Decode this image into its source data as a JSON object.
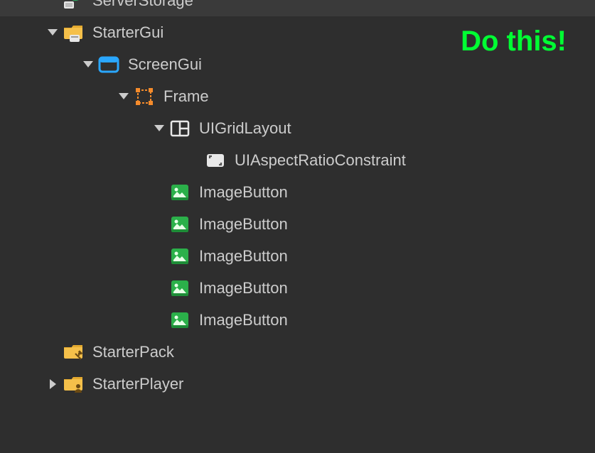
{
  "annotation": "Do this!",
  "tree": {
    "serverstorage": "ServerStorage",
    "startergui": "StarterGui",
    "screengui": "ScreenGui",
    "frame": "Frame",
    "uigridlayout": "UIGridLayout",
    "uiaspect": "UIAspectRatioConstraint",
    "imgbtn1": "ImageButton",
    "imgbtn2": "ImageButton",
    "imgbtn3": "ImageButton",
    "imgbtn4": "ImageButton",
    "imgbtn5": "ImageButton",
    "starterpack": "StarterPack",
    "starterplayer": "StarterPlayer"
  }
}
